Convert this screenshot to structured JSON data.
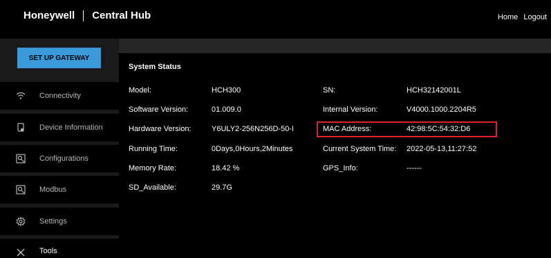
{
  "header": {
    "brand": "Honeywell",
    "product": "Central Hub",
    "links": [
      "Home",
      "Logout"
    ]
  },
  "sidebar": {
    "gateway_button": "SET UP GATEWAY",
    "items": [
      {
        "label": "Connectivity",
        "icon": "wifi-icon"
      },
      {
        "label": "Device Information",
        "icon": "device-icon"
      },
      {
        "label": "Configurations",
        "icon": "config-icon"
      },
      {
        "label": "Modbus",
        "icon": "modbus-icon"
      },
      {
        "label": "Settings",
        "icon": "gear-icon"
      },
      {
        "label": "Tools",
        "icon": "tools-icon"
      }
    ]
  },
  "status": {
    "title": "System Status",
    "rows": [
      {
        "label1": "Model:",
        "value1": "HCH300",
        "label2": "SN:",
        "value2": "HCH32142001L"
      },
      {
        "label1": "Software Version:",
        "value1": "01.009.0",
        "label2": "Internal Version:",
        "value2": "V4000.1000.2204R5"
      },
      {
        "label1": "Hardware Version:",
        "value1": "Y6ULY2-256N256D-50-I",
        "label2": "MAC Address:",
        "value2": "42:98:5C:54:32:D6"
      },
      {
        "label1": "Running Time:",
        "value1": "0Days,0Hours,2Minutes",
        "label2": "Current System Time:",
        "value2": "2022-05-13,11:27:52"
      },
      {
        "label1": "Memory Rate:",
        "value1": "18.42 %",
        "label2": "GPS_Info:",
        "value2": "------"
      },
      {
        "label1": "SD_Available:",
        "value1": "29.7G",
        "label2": "",
        "value2": ""
      }
    ]
  },
  "colors": {
    "accent": "#3a9ad9",
    "highlight": "#e0252a",
    "sidebar_bg": "#1a1a1a"
  }
}
